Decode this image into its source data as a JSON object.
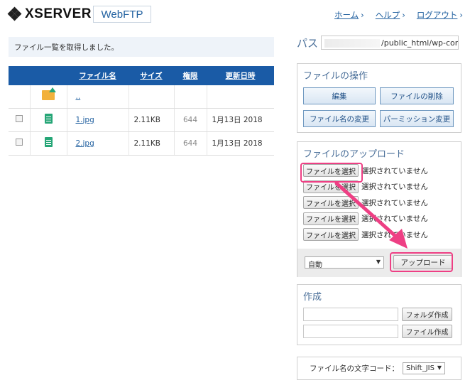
{
  "header": {
    "logo_text": "XSERVER",
    "app_badge": "WebFTP",
    "nav": [
      {
        "label": "ホーム",
        "chevron": "›"
      },
      {
        "label": "ヘルプ",
        "chevron": "›"
      },
      {
        "label": "ログアウト",
        "chevron": "›"
      }
    ]
  },
  "message": "ファイル一覧を取得しました。",
  "file_table": {
    "columns": [
      "ファイル名",
      "サイズ",
      "権限",
      "更新日時"
    ],
    "parent_link": "..",
    "rows": [
      {
        "name": "1.jpg",
        "size": "2.11KB",
        "perm": "644",
        "date": "1月13日 2018"
      },
      {
        "name": "2.jpg",
        "size": "2.11KB",
        "perm": "644",
        "date": "1月13日 2018"
      }
    ]
  },
  "path": {
    "label": "パス",
    "value": "/public_html/wp-conten"
  },
  "file_ops": {
    "title": "ファイルの操作",
    "buttons": [
      "編集",
      "ファイルの削除",
      "ファイル名の変更",
      "パーミッション変更"
    ]
  },
  "upload": {
    "title": "ファイルのアップロード",
    "pick_label": "ファイルを選択",
    "status": "選択されていません",
    "rows": 5,
    "mode_value": "自動",
    "upload_label": "アップロード"
  },
  "create": {
    "title": "作成",
    "folder_button": "フォルダ作成",
    "file_button": "ファイル作成"
  },
  "encoding": {
    "label": "ファイル名の文字コード：",
    "value": "Shift_JIS"
  },
  "colors": {
    "table_header": "#1a5ba6",
    "highlight": "#ee3f84",
    "link": "#1f5f9f"
  },
  "icons": {
    "logo": "xserver-logo-icon",
    "parent": "folder-up-icon",
    "file": "document-icon",
    "dropdown": "caret-down-icon",
    "annotation": "arrow-icon"
  }
}
